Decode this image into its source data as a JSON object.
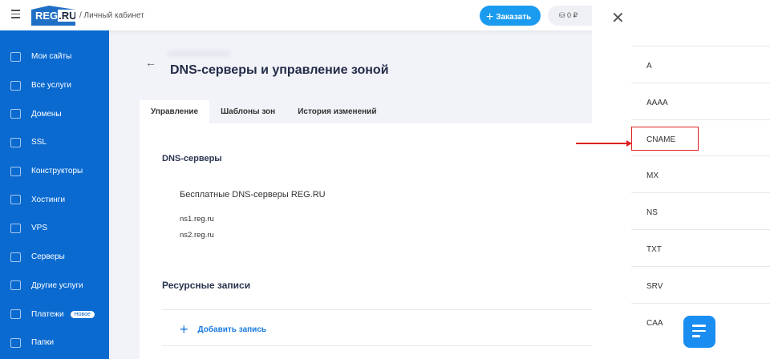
{
  "header": {
    "logo": "REG.RU",
    "logo_sub": "для бизнеса",
    "breadcrumb": "/ Личный кабинет",
    "order_label": "Заказать",
    "balance": "0 ₽"
  },
  "sidebar": {
    "items": [
      {
        "label": "Мои сайты"
      },
      {
        "label": "Все услуги"
      },
      {
        "label": "Домены"
      },
      {
        "label": "SSL"
      },
      {
        "label": "Конструкторы"
      },
      {
        "label": "Хостинги"
      },
      {
        "label": "VPS"
      },
      {
        "label": "Серверы"
      },
      {
        "label": "Другие услуги"
      },
      {
        "label": "Платежи",
        "badge": "Новое"
      },
      {
        "label": "Папки"
      }
    ]
  },
  "main": {
    "title": "DNS-серверы и управление зоной",
    "tabs": [
      {
        "label": "Управление"
      },
      {
        "label": "Шаблоны зон"
      },
      {
        "label": "История изменений"
      }
    ],
    "dns_heading": "DNS-серверы",
    "dns_type": "Бесплатные DNS-серверы REG.RU",
    "ns": [
      "ns1.reg.ru",
      "ns2.reg.ru"
    ],
    "records_heading": "Ресурсные записи",
    "add_record": "Добавить запись"
  },
  "panel": {
    "record_types": [
      "A",
      "AAAA",
      "CNAME",
      "MX",
      "NS",
      "TXT",
      "SRV",
      "CAA"
    ],
    "highlighted": "CNAME",
    "highlight_color": "#e02020"
  },
  "colors": {
    "sidebar": "#0a6ad0",
    "accent": "#1a9bf0"
  }
}
